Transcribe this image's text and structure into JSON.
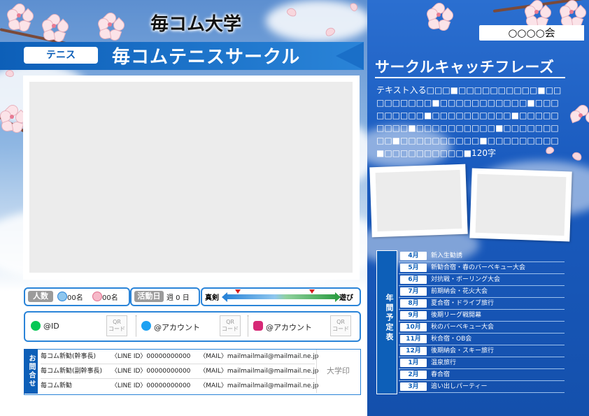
{
  "university": "毎コム大学",
  "sport_tag": "テニス",
  "circle_name": "毎コムテニスサークル",
  "organization": "○○○○会",
  "catch": {
    "title": "サークルキャッチフレーズ",
    "text": "テキスト入る□□□■□□□□□□□□□□■□□□□□□□□□■□□□□□□□□□□□■□□□□□□□□□■□□□□□□□□□□■□□□□□□□□□■□□□□□□□□□□■□□□□□□□□□■□□□□□□□□□□■□□□□□□□□□■□□□□□□□□□□■120字"
  },
  "info": {
    "members_label": "人数",
    "male_count": "00名",
    "female_count": "00名",
    "activity_label": "活動日",
    "activity_value": "週 0 日",
    "scale_left": "真剣",
    "scale_right": "遊び",
    "scale_markers": [
      0.12,
      0.78
    ]
  },
  "social": [
    {
      "icon": "line-icon",
      "handle": "@ID",
      "qr": "QR\nコード",
      "color": "#06c755"
    },
    {
      "icon": "twitter-icon",
      "handle": "@アカウント",
      "qr": "QR\nコード",
      "color": "#1da1f2"
    },
    {
      "icon": "instagram-icon",
      "handle": "@アカウント",
      "qr": "QR\nコード",
      "color": "#d62976"
    }
  ],
  "contact": {
    "side_label": "お問合せ",
    "seal": "大学印",
    "rows": [
      {
        "name": "毎コム新勧(幹事長)",
        "line": "〈LINE ID〉00000000000",
        "mail": "〈MAIL〉mailmailmail@mailmail.ne.jp"
      },
      {
        "name": "毎コム新勧(副幹事長)",
        "line": "〈LINE ID〉00000000000",
        "mail": "〈MAIL〉mailmailmail@mailmail.ne.jp"
      },
      {
        "name": "毎コム新勧",
        "line": "〈LINE ID〉00000000000",
        "mail": "〈MAIL〉mailmailmail@mailmail.ne.jp"
      }
    ]
  },
  "schedule": {
    "label": "年間予定表",
    "items": [
      {
        "month": "4月",
        "event": "新入生勧誘"
      },
      {
        "month": "5月",
        "event": "新勧合宿・春のバーベキュー大会"
      },
      {
        "month": "6月",
        "event": "対抗戦・ボーリング大会"
      },
      {
        "month": "7月",
        "event": "前期納会・花火大会"
      },
      {
        "month": "8月",
        "event": "夏合宿・ドライブ旅行"
      },
      {
        "month": "9月",
        "event": "後期リーグ戦開幕"
      },
      {
        "month": "10月",
        "event": "秋のバーベキュー大会"
      },
      {
        "month": "11月",
        "event": "秋合宿・OB会"
      },
      {
        "month": "12月",
        "event": "後期納会・スキー旅行"
      },
      {
        "month": "1月",
        "event": "温泉旅行"
      },
      {
        "month": "2月",
        "event": "春合宿"
      },
      {
        "month": "3月",
        "event": "追い出しパーティー"
      }
    ]
  }
}
